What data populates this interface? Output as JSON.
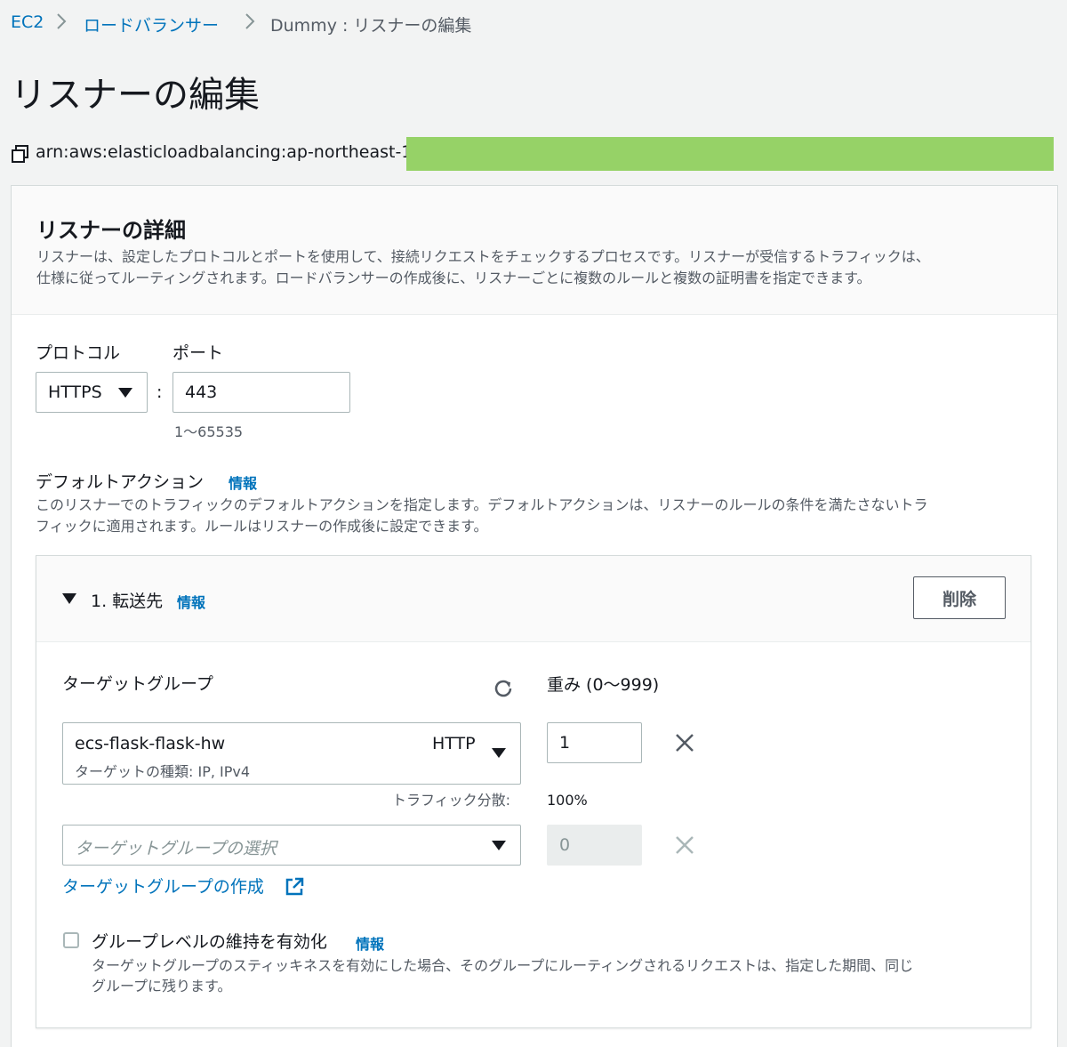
{
  "breadcrumb": {
    "items": [
      "EC2",
      "ロードバランサー"
    ],
    "current": "Dummy : リスナーの編集"
  },
  "page_title": "リスナーの編集",
  "arn_prefix": "arn:aws:elasticloadbalancing:ap-northeast-1:",
  "details": {
    "title": "リスナーの詳細",
    "description_line1": "リスナーは、設定したプロトコルとポートを使用して、接続リクエストをチェックするプロセスです。リスナーが受信するトラフィックは、",
    "description_line2": "仕様に従ってルーティングされます。ロードバランサーの作成後に、リスナーごとに複数のルールと複数の証明書を指定できます。"
  },
  "protocol": {
    "label": "プロトコル",
    "value": "HTTPS"
  },
  "port": {
    "label": "ポート",
    "value": "443",
    "hint": "1〜65535",
    "separator": ":"
  },
  "default_action": {
    "label": "デフォルトアクション",
    "info": "情報",
    "description_line1": "このリスナーでのトラフィックのデフォルトアクションを指定します。デフォルトアクションは、リスナーのルールの条件を満たさないトラ",
    "description_line2": "フィックに適用されます。ルールはリスナーの作成後に設定できます。"
  },
  "forward": {
    "title": "1. 転送先",
    "info": "情報",
    "delete_label": "削除",
    "target_group_label": "ターゲットグループ",
    "weight_label": "重み (0〜999)",
    "target": {
      "name": "ecs-flask-flask-hw",
      "protocol": "HTTP",
      "type_text": "ターゲットの種類: IP, IPv4",
      "weight": "1"
    },
    "traffic_label": "トラフィック分散:",
    "traffic_value": "100%",
    "select_placeholder": "ターゲットグループの選択",
    "empty_weight": "0",
    "create_link": "ターゲットグループの作成"
  },
  "stickiness": {
    "label": "グループレベルの維持を有効化",
    "info": "情報",
    "description_line1": "ターゲットグループのスティッキネスを有効にした場合、そのグループにルーティングされるリクエストは、指定した期間、同じ",
    "description_line2": "グループに残ります。",
    "checked": false
  },
  "colors": {
    "link": "#0073bb",
    "redaction": "#96d267",
    "background": "#f2f3f3"
  },
  "icons": [
    "copy-icon",
    "chevron-right-icon",
    "caret-down-icon",
    "refresh-icon",
    "close-icon",
    "external-link-icon"
  ]
}
